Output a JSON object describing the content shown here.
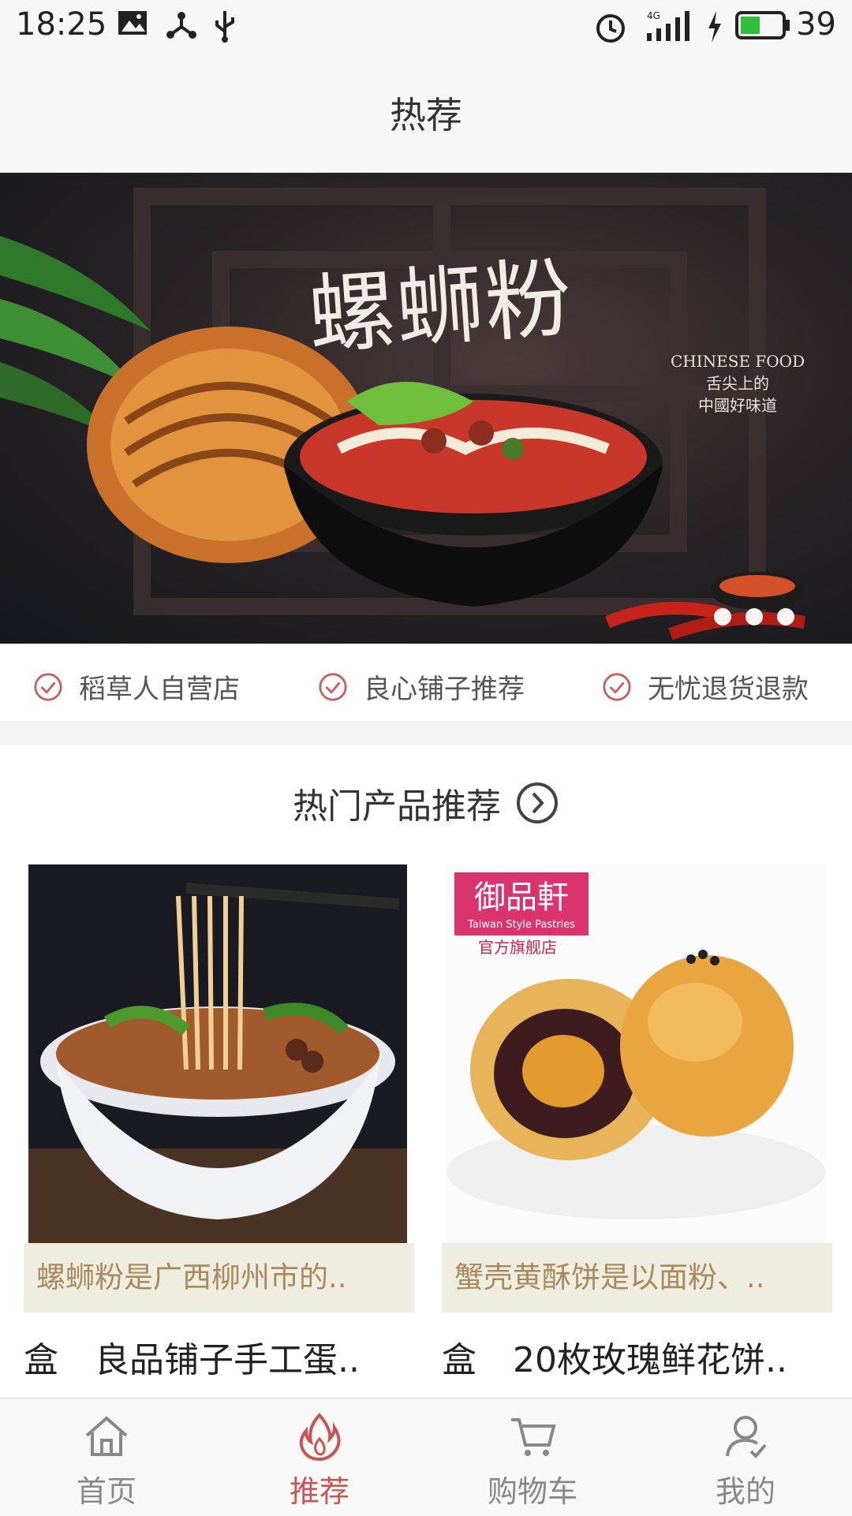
{
  "status": {
    "time": "18:25",
    "battery": "39",
    "network": "4G"
  },
  "page": {
    "title": "热荐"
  },
  "banner": {
    "title": "螺蛳粉",
    "subtitle_en": "CHINESE FOOD",
    "subtitle_cn1": "舌尖上的",
    "subtitle_cn2": "中國好味道",
    "pages": 3,
    "active_page": 0
  },
  "features": [
    {
      "label": "稻草人自营店",
      "icon": "check-circle-icon"
    },
    {
      "label": "良心铺子推荐",
      "icon": "check-circle-icon"
    },
    {
      "label": "无忧退货退款",
      "icon": "check-circle-icon"
    }
  ],
  "hot_section": {
    "title": "热门产品推荐",
    "products": [
      {
        "description": "螺蛳粉是广西柳州市的..",
        "unit": "盒",
        "name": "良品铺子手工蛋.."
      },
      {
        "description": "蟹壳黄酥饼是以面粉、..",
        "unit": "盒",
        "name": "20枚玫瑰鲜花饼.."
      }
    ]
  },
  "product2_brand": {
    "name": "御品軒",
    "sub": "Taiwan Style Pastries",
    "store": "官方旗舰店"
  },
  "tabs": [
    {
      "label": "首页",
      "icon": "home-icon"
    },
    {
      "label": "推荐",
      "icon": "flame-icon",
      "active": true
    },
    {
      "label": "购物车",
      "icon": "cart-icon"
    },
    {
      "label": "我的",
      "icon": "user-icon"
    }
  ],
  "colors": {
    "accent": "#c85454",
    "desc_bg": "#efece0",
    "desc_text": "#a78a5d"
  }
}
